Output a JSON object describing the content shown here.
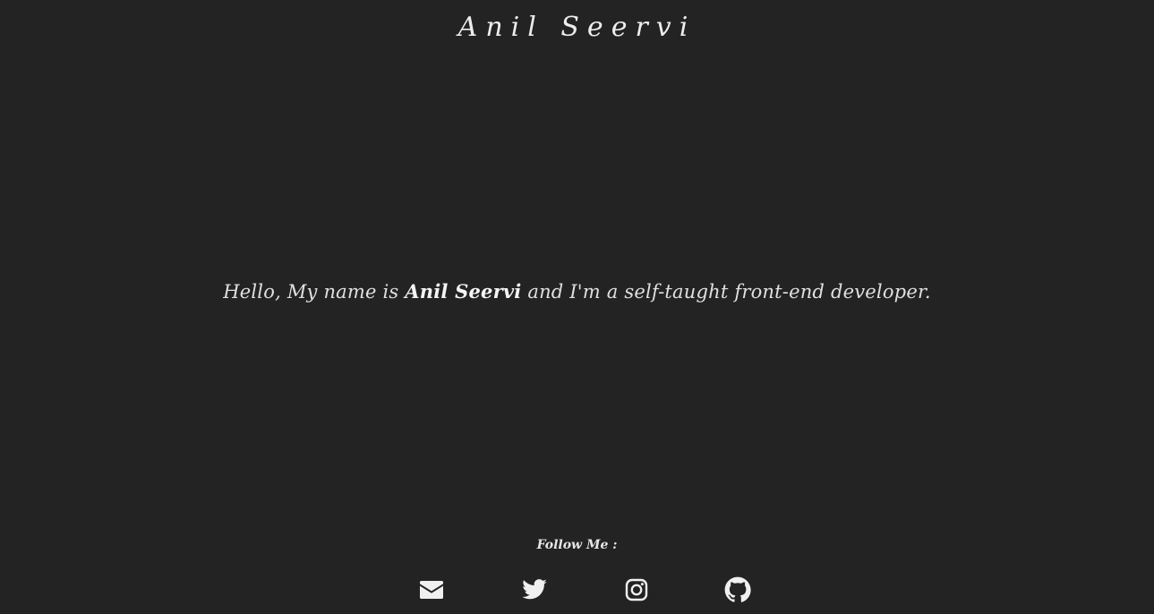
{
  "header": {
    "title": "Anil Seervi"
  },
  "intro": {
    "prefix": "Hello, My name is ",
    "name": "Anil Seervi",
    "suffix": " and I'm a self-taught front-end developer."
  },
  "footer": {
    "follow_label": "Follow Me :",
    "links": [
      {
        "icon": "envelope-icon"
      },
      {
        "icon": "twitter-icon"
      },
      {
        "icon": "instagram-icon"
      },
      {
        "icon": "github-icon"
      }
    ]
  },
  "colors": {
    "background": "#232323",
    "text": "#e8e8e8"
  }
}
